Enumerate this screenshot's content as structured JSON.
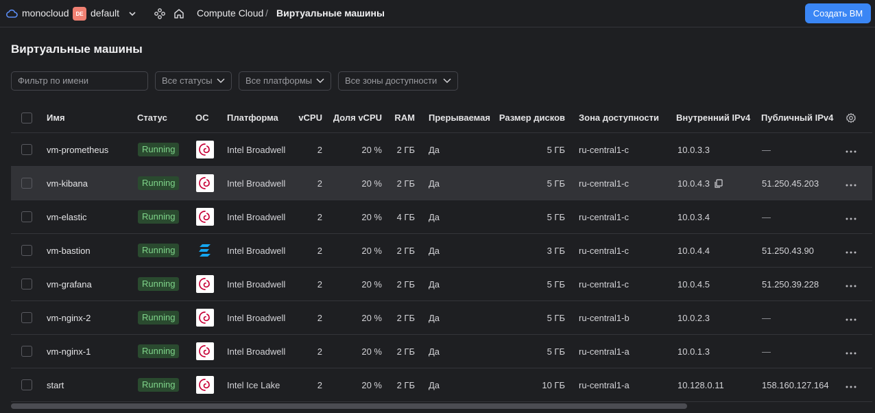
{
  "topbar": {
    "org_name": "monocloud",
    "folder_badge": "DE",
    "folder_name": "default",
    "breadcrumb_service": "Compute Cloud",
    "breadcrumb_sep": "/",
    "breadcrumb_current": "Виртуальные машины",
    "create_button": "Создать ВМ",
    "accent_color": "#3a86f5",
    "badge_color": "#f08072"
  },
  "page": {
    "title": "Виртуальные машины"
  },
  "filters": {
    "name_placeholder": "Фильтр по имени",
    "status": "Все статусы",
    "platform": "Все платформы",
    "zone": "Все зоны доступности"
  },
  "table": {
    "columns": {
      "name": "Имя",
      "status": "Статус",
      "os": "ОС",
      "platform": "Платформа",
      "vcpu": "vCPU",
      "fraction": "Доля vCPU",
      "ram": "RAM",
      "preemptible": "Прерываемая",
      "disk": "Размер дисков",
      "zone": "Зона доступности",
      "internal_ip": "Внутренний IPv4",
      "public_ip": "Публичный IPv4"
    },
    "rows": [
      {
        "name": "vm-prometheus",
        "status": "Running",
        "os": "debian",
        "platform": "Intel Broadwell",
        "vcpu": "2",
        "fraction": "20 %",
        "ram": "2 ГБ",
        "preemptible": "Да",
        "disk": "5 ГБ",
        "zone": "ru-central1-c",
        "internal_ip": "10.0.3.3",
        "public_ip": "—"
      },
      {
        "name": "vm-kibana",
        "status": "Running",
        "os": "debian",
        "platform": "Intel Broadwell",
        "vcpu": "2",
        "fraction": "20 %",
        "ram": "2 ГБ",
        "preemptible": "Да",
        "disk": "5 ГБ",
        "zone": "ru-central1-c",
        "internal_ip": "10.0.4.3",
        "public_ip": "51.250.45.203"
      },
      {
        "name": "vm-elastic",
        "status": "Running",
        "os": "debian",
        "platform": "Intel Broadwell",
        "vcpu": "2",
        "fraction": "20 %",
        "ram": "4 ГБ",
        "preemptible": "Да",
        "disk": "5 ГБ",
        "zone": "ru-central1-c",
        "internal_ip": "10.0.3.4",
        "public_ip": "—"
      },
      {
        "name": "vm-bastion",
        "status": "Running",
        "os": "zorin",
        "platform": "Intel Broadwell",
        "vcpu": "2",
        "fraction": "20 %",
        "ram": "2 ГБ",
        "preemptible": "Да",
        "disk": "3 ГБ",
        "zone": "ru-central1-c",
        "internal_ip": "10.0.4.4",
        "public_ip": "51.250.43.90"
      },
      {
        "name": "vm-grafana",
        "status": "Running",
        "os": "debian",
        "platform": "Intel Broadwell",
        "vcpu": "2",
        "fraction": "20 %",
        "ram": "2 ГБ",
        "preemptible": "Да",
        "disk": "5 ГБ",
        "zone": "ru-central1-c",
        "internal_ip": "10.0.4.5",
        "public_ip": "51.250.39.228"
      },
      {
        "name": "vm-nginx-2",
        "status": "Running",
        "os": "debian",
        "platform": "Intel Broadwell",
        "vcpu": "2",
        "fraction": "20 %",
        "ram": "2 ГБ",
        "preemptible": "Да",
        "disk": "5 ГБ",
        "zone": "ru-central1-b",
        "internal_ip": "10.0.2.3",
        "public_ip": "—"
      },
      {
        "name": "vm-nginx-1",
        "status": "Running",
        "os": "debian",
        "platform": "Intel Broadwell",
        "vcpu": "2",
        "fraction": "20 %",
        "ram": "2 ГБ",
        "preemptible": "Да",
        "disk": "5 ГБ",
        "zone": "ru-central1-a",
        "internal_ip": "10.0.1.3",
        "public_ip": "—"
      },
      {
        "name": "start",
        "status": "Running",
        "os": "debian",
        "platform": "Intel Ice Lake",
        "vcpu": "2",
        "fraction": "20 %",
        "ram": "2 ГБ",
        "preemptible": "Да",
        "disk": "10 ГБ",
        "zone": "ru-central1-a",
        "internal_ip": "10.128.0.11",
        "public_ip": "158.160.127.164"
      }
    ]
  }
}
